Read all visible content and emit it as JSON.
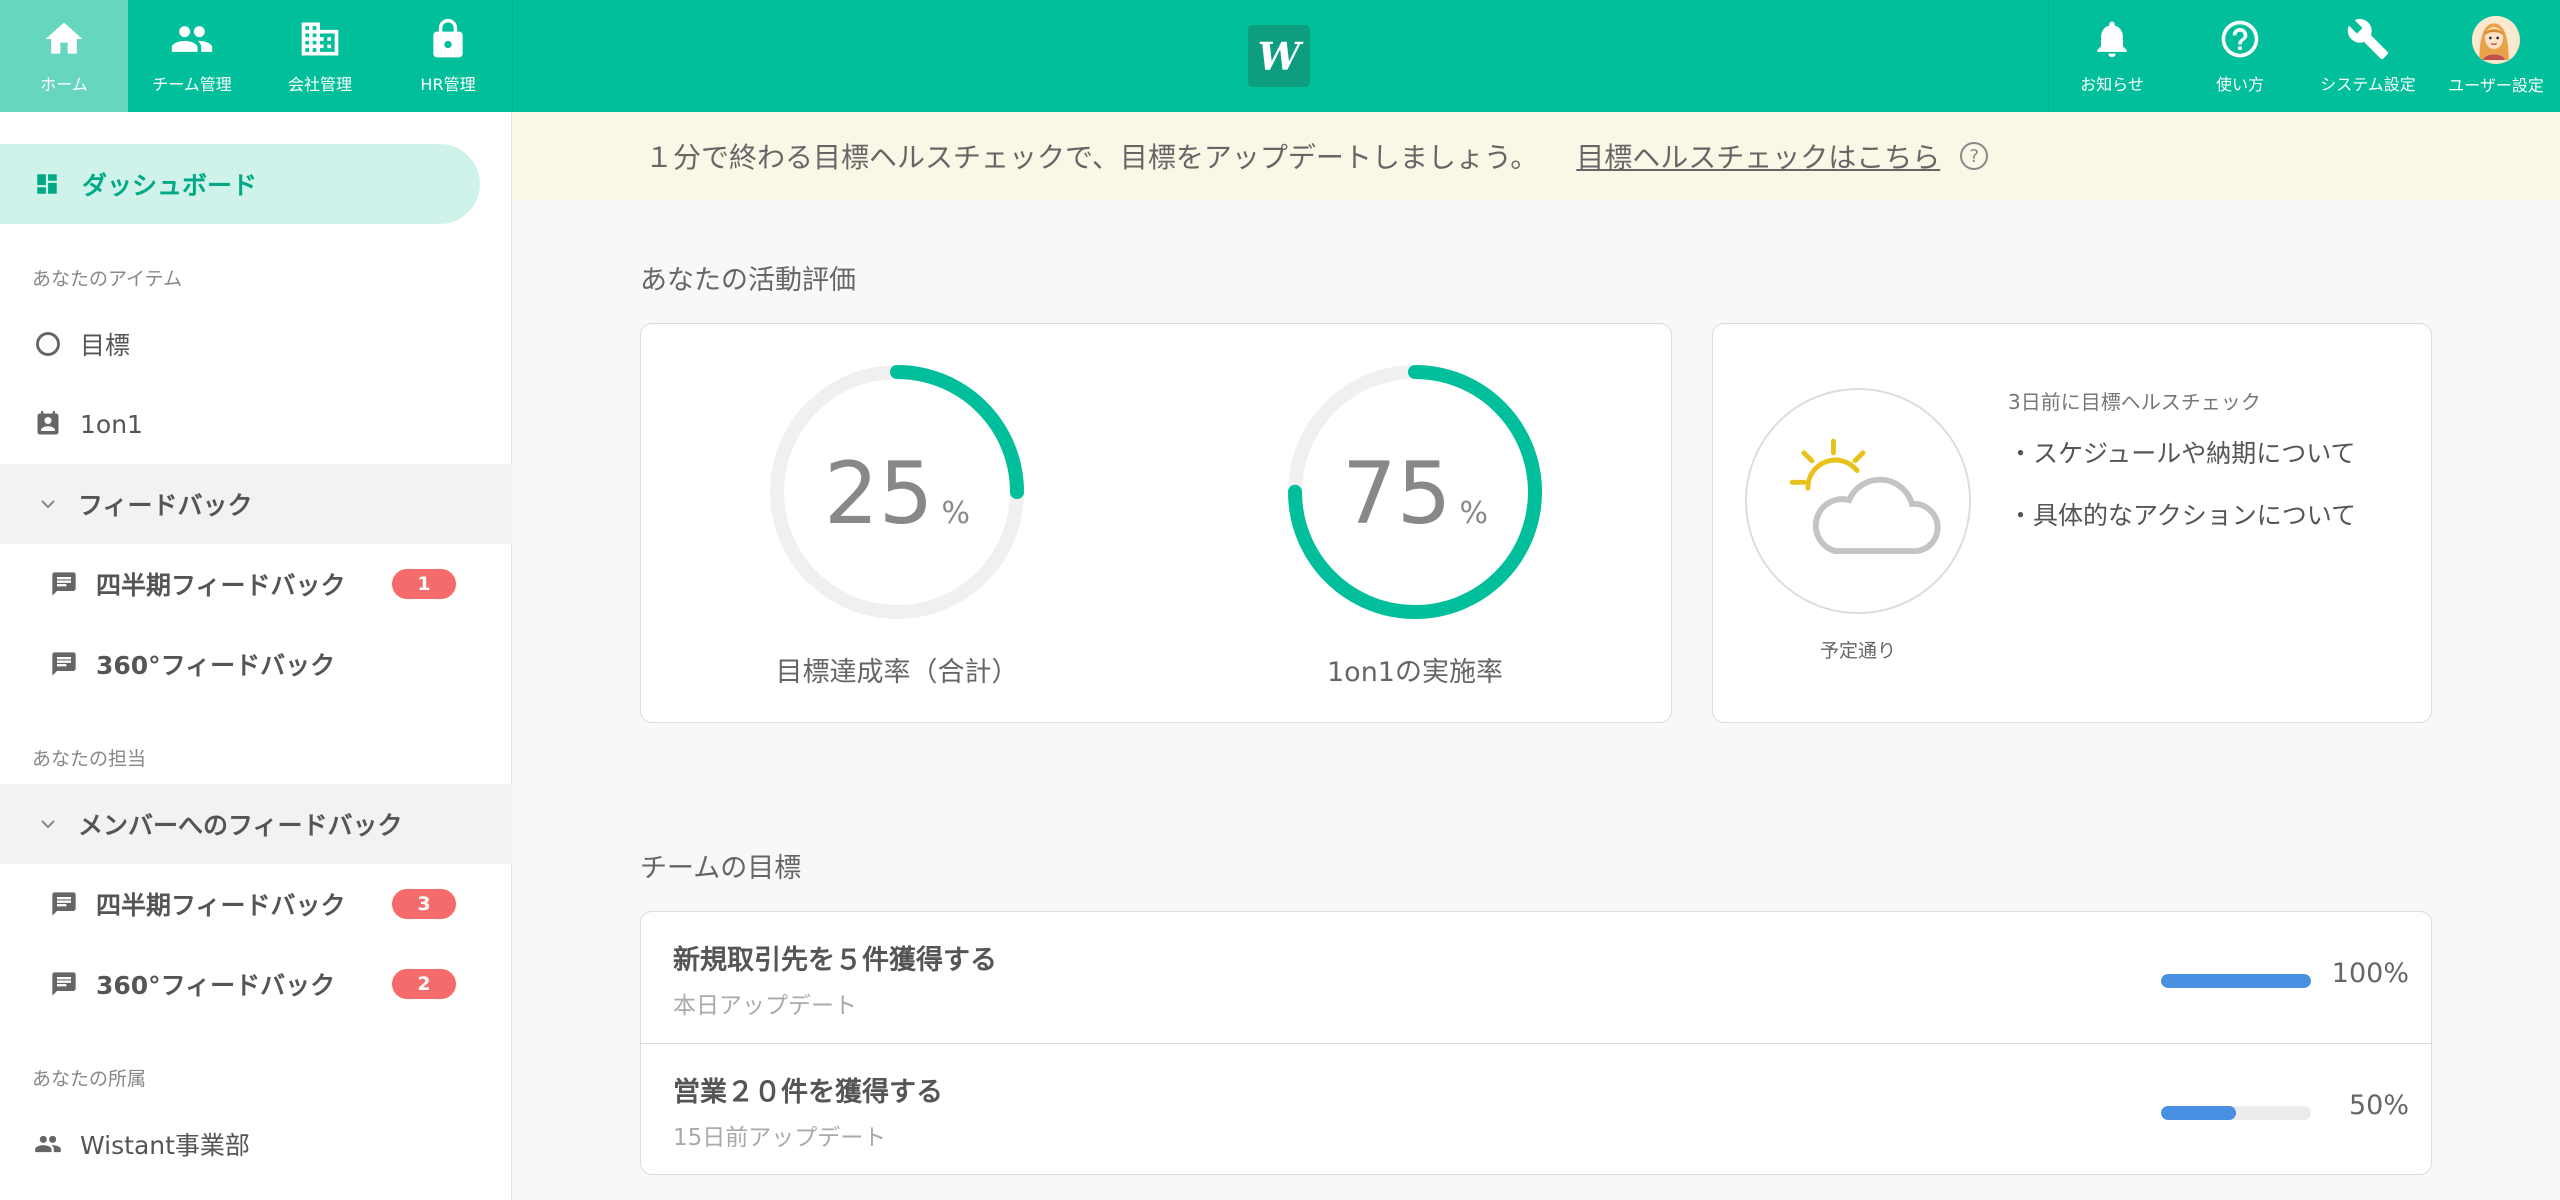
{
  "topnav": {
    "left": [
      {
        "label": "ホーム",
        "icon": "home-icon",
        "active": true
      },
      {
        "label": "チーム管理",
        "icon": "team-icon"
      },
      {
        "label": "会社管理",
        "icon": "building-icon"
      },
      {
        "label": "HR管理",
        "icon": "lock-icon"
      }
    ],
    "right": [
      {
        "label": "お知らせ",
        "icon": "bell-icon"
      },
      {
        "label": "使い方",
        "icon": "help-circle-icon"
      },
      {
        "label": "システム設定",
        "icon": "wrench-icon"
      },
      {
        "label": "ユーザー設定",
        "icon": "user-avatar"
      }
    ],
    "logo": "W"
  },
  "sidebar": {
    "dashboard": "ダッシュボード",
    "sections": {
      "items": "あなたのアイテム",
      "responsible": "あなたの担当",
      "belongs": "あなたの所属"
    },
    "goal": "目標",
    "one_on_one": "1on1",
    "feedback_group": "フィードバック",
    "quarter_feedback": "四半期フィードバック",
    "quarter_feedback_badge": "1",
    "feedback_360": "360°フィードバック",
    "member_feedback_group": "メンバーへのフィードバック",
    "member_quarter_feedback": "四半期フィードバック",
    "member_quarter_badge": "3",
    "member_feedback_360": "360°フィードバック",
    "member_360_badge": "2",
    "department": "Wistant事業部"
  },
  "banner": {
    "text": "１分で終わる目標ヘルスチェックで、目標をアップデートしましょう。",
    "link": "目標ヘルスチェックはこちら",
    "help": "?"
  },
  "activity": {
    "title": "あなたの活動評価",
    "goal_rate": {
      "value": 25,
      "unit": "%",
      "label": "目標達成率（合計）"
    },
    "one_on_one_rate": {
      "value": 75,
      "unit": "%",
      "label": "1on1の実施率"
    }
  },
  "health_check": {
    "date": "3日前に目標ヘルスチェック",
    "items": [
      "・スケジュールや納期について",
      "・具体的なアクションについて"
    ],
    "status": "予定通り",
    "icon": "partly-cloudy-icon"
  },
  "team_goals": {
    "title": "チームの目標",
    "rows": [
      {
        "title": "新規取引先を５件獲得する",
        "updated": "本日アップデート",
        "progress": 100,
        "progress_label": "100%"
      },
      {
        "title": "営業２０件を獲得する",
        "updated": "15日前アップデート",
        "progress": 50,
        "progress_label": "50%"
      }
    ]
  },
  "colors": {
    "brand": "#00bf9a",
    "gauge": "#00bf9a",
    "progress": "#4a90e2",
    "badge": "#f46b6b"
  }
}
